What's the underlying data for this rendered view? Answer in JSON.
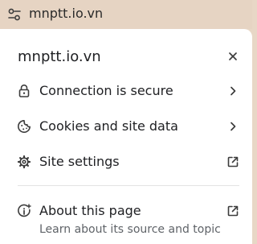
{
  "urlbar": {
    "site_info_icon": "tune-icon",
    "url": "mnptt.io.vn"
  },
  "panel": {
    "title": "mnptt.io.vn",
    "close_icon": "close-icon",
    "items": [
      {
        "label": "Connection is secure",
        "icon": "lock-icon",
        "trailing": "chevron-right-icon"
      },
      {
        "label": "Cookies and site data",
        "icon": "cookie-icon",
        "trailing": "chevron-right-icon"
      },
      {
        "label": "Site settings",
        "icon": "gear-icon",
        "trailing": "open-in-new-icon"
      }
    ],
    "about": {
      "label": "About this page",
      "sublabel": "Learn about its source and topic",
      "icon": "about-page-icon",
      "trailing": "open-in-new-icon"
    }
  }
}
